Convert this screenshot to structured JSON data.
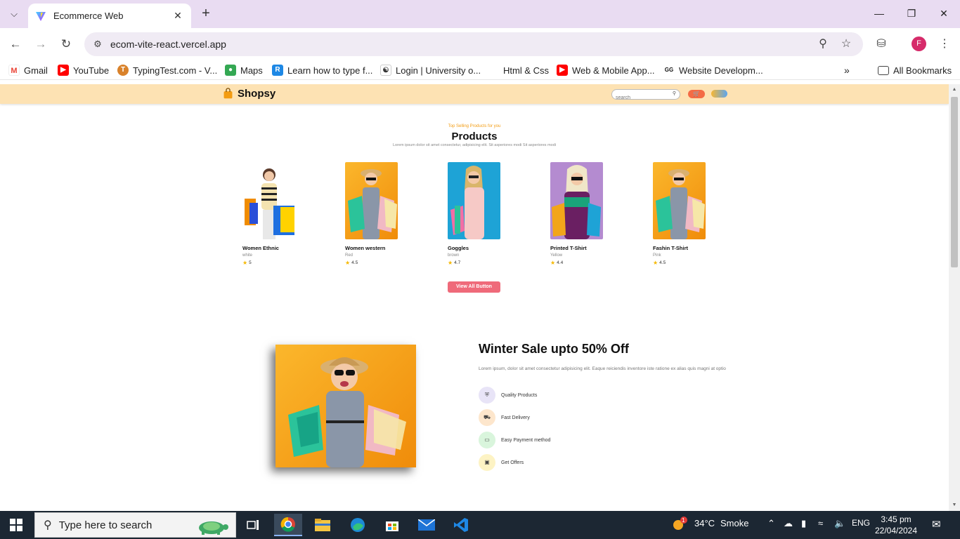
{
  "browser": {
    "tab_title": "Ecommerce Web",
    "url": "ecom-vite-react.vercel.app",
    "profile_initial": "F",
    "bookmarks": [
      {
        "label": "Gmail",
        "icon": "gmail-icon"
      },
      {
        "label": "YouTube",
        "icon": "youtube-icon"
      },
      {
        "label": "TypingTest.com - V...",
        "icon": "typingtest-icon"
      },
      {
        "label": "Maps",
        "icon": "maps-icon"
      },
      {
        "label": "Learn how to type f...",
        "icon": "typing-club-icon"
      },
      {
        "label": "Login | University o...",
        "icon": "university-icon"
      },
      {
        "label": "Html & Css",
        "icon": "blank-icon"
      },
      {
        "label": "Web & Mobile App...",
        "icon": "youtube-icon"
      },
      {
        "label": "Website Developm...",
        "icon": "geeks-icon"
      }
    ],
    "all_bookmarks": "All Bookmarks"
  },
  "site": {
    "brand": "Shopsy",
    "search_placeholder": "search",
    "colors": {
      "nav_bg": "#fde2b3",
      "accent": "#f39c12",
      "button": "#ef6a7a"
    }
  },
  "products_section": {
    "subtitle": "Top Selling Products for you",
    "title": "Products",
    "description": "Lorem ipsum dolor sit amet consectetur, adipisicing elit. Sit asperiores modi Sit asperiores modi",
    "items": [
      {
        "name": "Women Ethnic",
        "color": "white",
        "rating": "5"
      },
      {
        "name": "Women western",
        "color": "Red",
        "rating": "4.5"
      },
      {
        "name": "Goggles",
        "color": "brown",
        "rating": "4.7"
      },
      {
        "name": "Printed T-Shirt",
        "color": "Yellow",
        "rating": "4.4"
      },
      {
        "name": "Fashin T-Shirt",
        "color": "Pink",
        "rating": "4.5"
      }
    ],
    "view_all": "View All Button"
  },
  "banner": {
    "title": "Winter Sale upto 50% Off",
    "description": "Lorem ipsum, dolor sit amet consectetur adipisicing elit. Eaque reiciendis inventore iste ratione ex alias quis magni at optio",
    "features": [
      {
        "label": "Quality Products",
        "icon": "shield-icon",
        "color": "#e8e4f7"
      },
      {
        "label": "Fast Delivery",
        "icon": "truck-icon",
        "color": "#fde6cc"
      },
      {
        "label": "Easy Payment method",
        "icon": "wallet-icon",
        "color": "#d9f5dc"
      },
      {
        "label": "Get Offers",
        "icon": "gift-icon",
        "color": "#fdf3c4"
      }
    ]
  },
  "taskbar": {
    "search_placeholder": "Type here to search",
    "weather_temp": "34°C",
    "weather_desc": "Smoke",
    "language": "ENG",
    "time": "3:45 pm",
    "date": "22/04/2024",
    "weather_badge": "1"
  }
}
